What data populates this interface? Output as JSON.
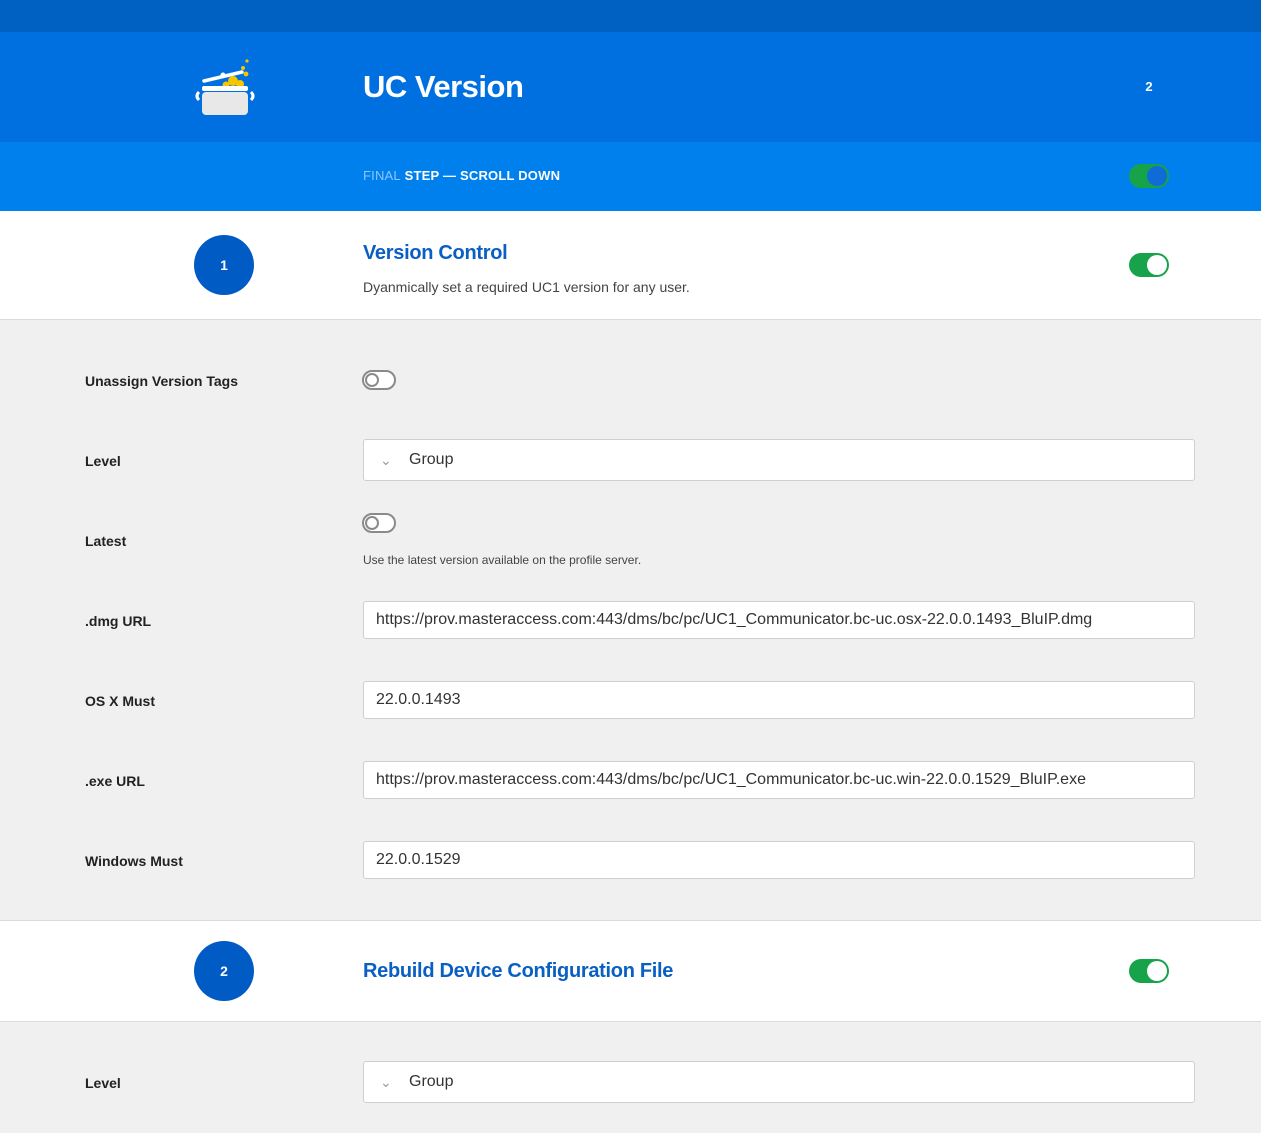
{
  "header": {
    "title": "UC Version",
    "count": "2"
  },
  "step_bar": {
    "faded_word": "FINAL",
    "label": "STEP — SCROLL DOWN"
  },
  "sections": [
    {
      "number": "1",
      "title": "Version Control",
      "description": "Dyanmically set a required UC1 version for any user.",
      "enabled": true,
      "fields": {
        "unassign_label": "Unassign Version Tags",
        "level_label": "Level",
        "level_value": "Group",
        "latest_label": "Latest",
        "latest_hint": "Use the latest version available on the profile server.",
        "dmg_label": ".dmg URL",
        "dmg_value": "https://prov.masteraccess.com:443/dms/bc/pc/UC1_Communicator.bc-uc.osx-22.0.0.1493_BluIP.dmg",
        "osx_label": "OS X Must",
        "osx_value": "22.0.0.1493",
        "exe_label": ".exe URL",
        "exe_value": "https://prov.masteraccess.com:443/dms/bc/pc/UC1_Communicator.bc-uc.win-22.0.0.1529_BluIP.exe",
        "win_label": "Windows Must",
        "win_value": "22.0.0.1529"
      }
    },
    {
      "number": "2",
      "title": "Rebuild Device Configuration File",
      "enabled": true,
      "fields": {
        "level_label": "Level",
        "level_value": "Group"
      }
    }
  ],
  "colors": {
    "top_strip": "#0061c2",
    "header": "#0070e0",
    "step_bar": "#0080ed",
    "accent": "#0a5fc4",
    "toggle_on": "#16a34a"
  },
  "icons": {
    "logo": "cooking-pot-icon",
    "select_arrow": "chevron-down-icon"
  }
}
